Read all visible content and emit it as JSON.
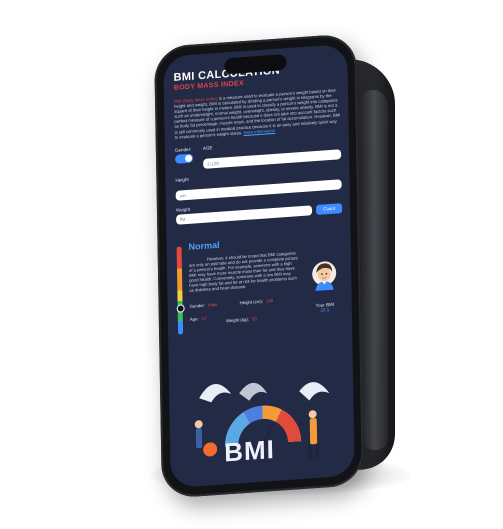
{
  "header": {
    "title": "BMI CALCULATION",
    "subtitle": "BODY MASS INDEX"
  },
  "intro": {
    "highlight": "BMI (Body Mass Index)",
    "text": "is a measure used to evaluate a person's weight based on their height and weight. BMI is calculated by dividing a person's weight in kilograms by the square of their height in meters. BMI is used to classify a person's weight into categories such as underweight, normal weight, overweight, obesity, or severe obesity. BMI is not a perfect measure of a person's health because it does not take into account factors such as body fat percentage, muscle mass, and the location of fat accumulation. However, BMI is still commonly used in medical practice because it is an easy and relatively quick way to evaluate a person's weight status.",
    "link": "More Information"
  },
  "form": {
    "gender_label": "Gender:",
    "age_label": "AGE",
    "age_placeholder": "2-120",
    "height_label": "Height",
    "height_placeholder": "cm",
    "weight_label": "Weight",
    "weight_placeholder": "kg",
    "count_button": "Count"
  },
  "result": {
    "status": "Normal",
    "description": "However, it should be noted that BMI categories are only an estimate and do not provide a complete picture of a person's health. For example, someone with a high BMI may have more muscle mass than fat and thus have good health. Conversely, someone with a low BMI may have high body fat and be at risk for health problems such as diabetes and heart disease.",
    "gender_label": "Gender:",
    "gender_value": "Male",
    "height_label": "Height (cm):",
    "height_value": "165",
    "age_label": "Age:",
    "age_value": "17",
    "weight_label": "Weight (kg):",
    "weight_value": "63",
    "your_bmi_label": "Your BMI",
    "your_bmi_value": "23.1"
  },
  "illustration": {
    "big_text": "BMI"
  },
  "colors": {
    "screen_bg": "#222a45",
    "accent_red": "#e2444a",
    "accent_blue": "#3d8bff"
  }
}
